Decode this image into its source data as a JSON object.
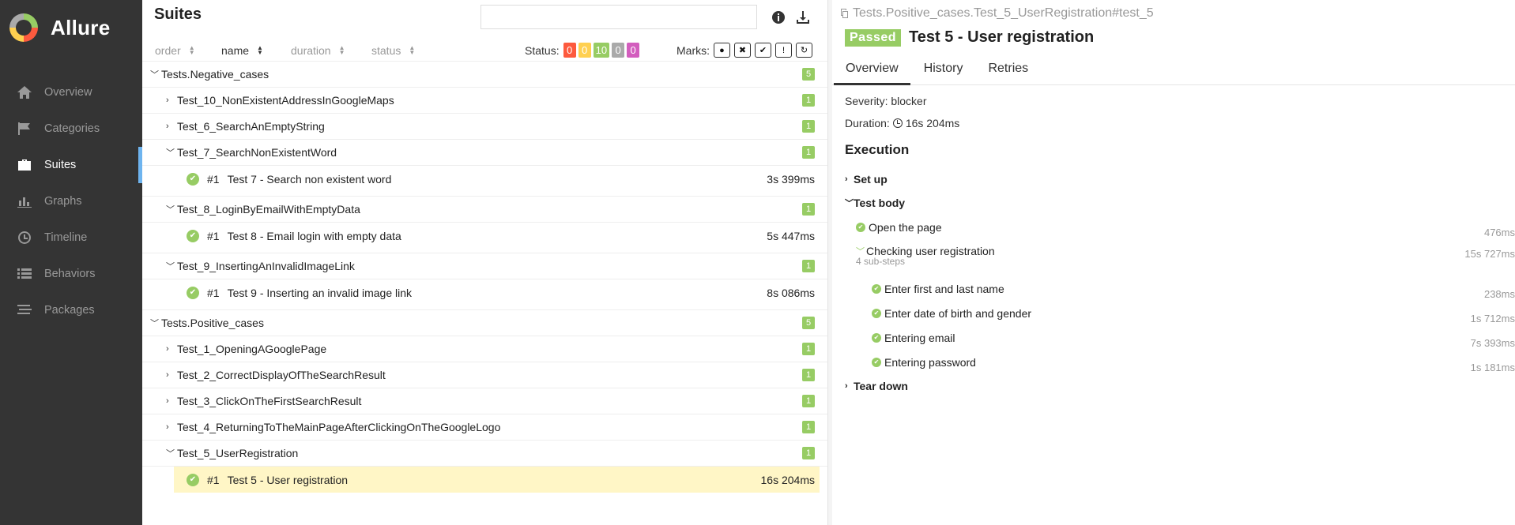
{
  "app": {
    "name": "Allure"
  },
  "sidebar": {
    "items": [
      {
        "label": "Overview",
        "icon": "home-icon"
      },
      {
        "label": "Categories",
        "icon": "flag-icon"
      },
      {
        "label": "Suites",
        "icon": "briefcase-icon",
        "active": true
      },
      {
        "label": "Graphs",
        "icon": "bar-chart-icon"
      },
      {
        "label": "Timeline",
        "icon": "clock-icon"
      },
      {
        "label": "Behaviors",
        "icon": "list-icon"
      },
      {
        "label": "Packages",
        "icon": "packages-icon"
      }
    ]
  },
  "suites": {
    "title": "Suites",
    "search": {
      "value": "",
      "placeholder": ""
    },
    "sort": {
      "order": "order",
      "name": "name",
      "duration": "duration",
      "status": "status"
    },
    "status_label": "Status:",
    "status_counts": {
      "failed": "0",
      "broken": "0",
      "passed": "10",
      "skipped": "0",
      "unknown": "0"
    },
    "marks_label": "Marks:",
    "colors": {
      "failed": "#fd5a3e",
      "broken": "#ffd050",
      "passed": "#97cc64",
      "skipped": "#aaaaaa",
      "unknown": "#d35ebe"
    },
    "groups": [
      {
        "name": "Tests.Negative_cases",
        "count": "5",
        "children": [
          {
            "name": "Test_10_NonExistentAddressInGoogleMaps",
            "count": "1"
          },
          {
            "name": "Test_6_SearchAnEmptyString",
            "count": "1"
          },
          {
            "name": "Test_7_SearchNonExistentWord",
            "count": "1",
            "leaf": {
              "num": "#1",
              "name": "Test 7 - Search non existent word",
              "duration": "3s 399ms"
            }
          },
          {
            "name": "Test_8_LoginByEmailWithEmptyData",
            "count": "1",
            "leaf": {
              "num": "#1",
              "name": "Test 8 - Email login with empty data",
              "duration": "5s 447ms"
            }
          },
          {
            "name": "Test_9_InsertingAnInvalidImageLink",
            "count": "1",
            "leaf": {
              "num": "#1",
              "name": "Test 9 - Inserting an invalid image link",
              "duration": "8s 086ms"
            }
          }
        ]
      },
      {
        "name": "Tests.Positive_cases",
        "count": "5",
        "children": [
          {
            "name": "Test_1_OpeningAGooglePage",
            "count": "1"
          },
          {
            "name": "Test_2_CorrectDisplayOfTheSearchResult",
            "count": "1"
          },
          {
            "name": "Test_3_ClickOnTheFirstSearchResult",
            "count": "1"
          },
          {
            "name": "Test_4_ReturningToTheMainPageAfterClickingOnTheGoogleLogo",
            "count": "1"
          },
          {
            "name": "Test_5_UserRegistration",
            "count": "1",
            "leaf": {
              "num": "#1",
              "name": "Test 5 - User registration",
              "duration": "16s 204ms"
            }
          }
        ]
      }
    ]
  },
  "detail": {
    "breadcrumb": "Tests.Positive_cases.Test_5_UserRegistration#test_5",
    "status": "Passed",
    "title": "Test 5 - User registration",
    "tabs": [
      "Overview",
      "History",
      "Retries"
    ],
    "severity": "Severity: blocker",
    "duration_label": "Duration:",
    "duration": "16s 204ms",
    "execution_title": "Execution",
    "setup": "Set up",
    "test_body": "Test body",
    "teardown": "Tear down",
    "steps": {
      "open": {
        "name": "Open the page",
        "duration": "476ms"
      },
      "checking": {
        "name": "Checking user registration",
        "substeps": "4 sub-steps",
        "duration": "15s 727ms"
      },
      "first": {
        "name": "Enter first and last name",
        "duration": "238ms"
      },
      "dob": {
        "name": "Enter date of birth and gender",
        "duration": "1s 712ms"
      },
      "email": {
        "name": "Entering email",
        "duration": "7s 393ms"
      },
      "password": {
        "name": "Entering password",
        "duration": "1s 181ms"
      }
    }
  }
}
